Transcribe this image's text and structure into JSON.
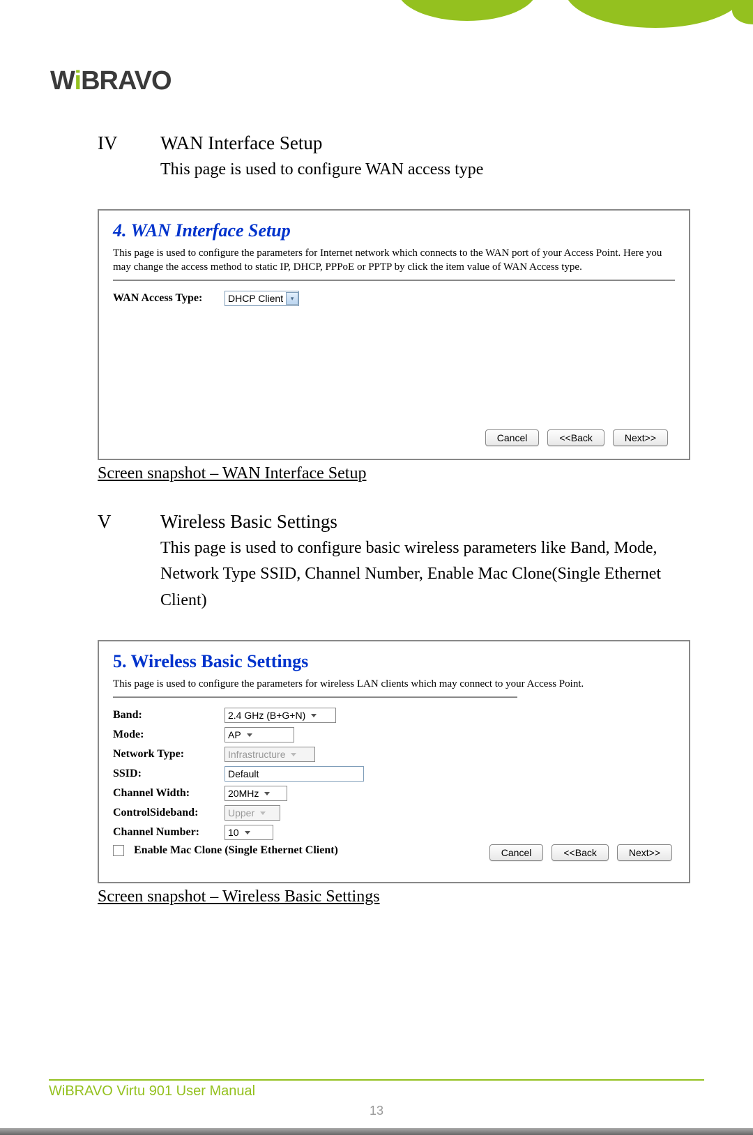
{
  "logo": "WiBRAVO",
  "section_iv": {
    "numeral": "IV",
    "title": "WAN Interface Setup",
    "desc": "This page is used to configure WAN access type"
  },
  "screenshot_iv": {
    "title": "4. WAN Interface Setup",
    "desc": "This page is used to configure the parameters for Internet network which connects to the WAN port of your Access Point. Here you may change the access method to static IP, DHCP, PPPoE or PPTP by click the item value of WAN Access type.",
    "field_label": "WAN Access Type:",
    "field_value": "DHCP Client",
    "btn_cancel": "Cancel",
    "btn_back": "<<Back",
    "btn_next": "Next>>"
  },
  "caption_iv": "Screen snapshot – WAN Interface Setup",
  "section_v": {
    "numeral": "V",
    "title": "Wireless Basic Settings",
    "desc": "This page is used to configure basic wireless parameters like Band, Mode, Network Type SSID, Channel Number, Enable Mac Clone(Single Ethernet Client)"
  },
  "screenshot_v": {
    "title": "5. Wireless Basic Settings",
    "desc": "This page is used to configure the parameters for wireless LAN clients which may connect to your Access Point.",
    "fields": {
      "band_label": "Band:",
      "band_value": "2.4 GHz (B+G+N)",
      "mode_label": "Mode:",
      "mode_value": "AP",
      "network_label": "Network Type:",
      "network_value": "Infrastructure",
      "ssid_label": "SSID:",
      "ssid_value": "Default",
      "chwidth_label": "Channel Width:",
      "chwidth_value": "20MHz",
      "sideband_label": "ControlSideband:",
      "sideband_value": "Upper",
      "chnum_label": "Channel Number:",
      "chnum_value": "10",
      "macclone_label": "Enable Mac Clone (Single Ethernet Client)"
    },
    "btn_cancel": "Cancel",
    "btn_back": "<<Back",
    "btn_next": "Next>>"
  },
  "caption_v": "Screen snapshot – Wireless Basic Settings",
  "footer": "WiBRAVO Virtu 901 User Manual",
  "page_number": "13"
}
